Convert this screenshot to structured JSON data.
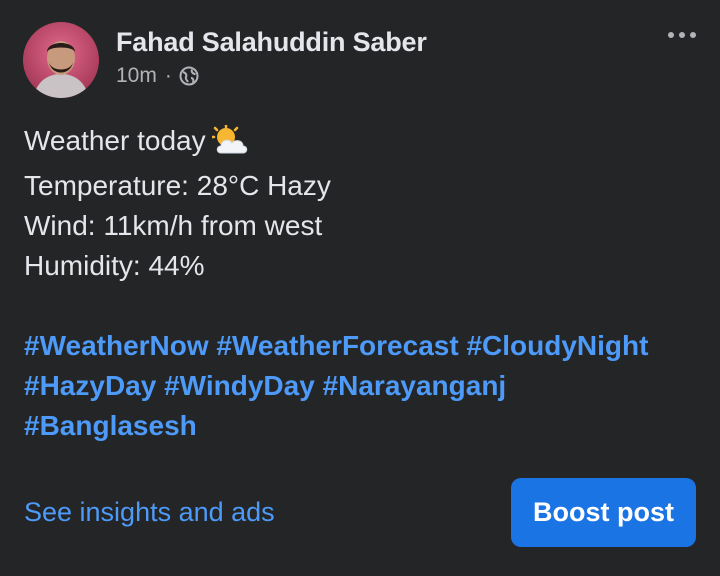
{
  "post": {
    "author": "Fahad Salahuddin Saber",
    "timestamp": "10m",
    "separator": "·",
    "privacy_icon": "globe-icon",
    "more_icon": "more-options-icon",
    "body": {
      "line1": "Weather today",
      "line1_emoji": "sun-behind-cloud-icon",
      "line2": "Temperature: 28°C Hazy",
      "line3": "Wind: 11km/h from west",
      "line4": "Humidity: 44%"
    },
    "hashtags": {
      "row1": [
        "#WeatherNow",
        "#WeatherForecast",
        "#CloudyNight"
      ],
      "row2": [
        "#HazyDay",
        "#WindyDay",
        "#Narayanganj"
      ],
      "row3": [
        "#Banglasesh"
      ]
    },
    "footer": {
      "insights_link": "See insights and ads",
      "boost_button": "Boost post"
    }
  },
  "colors": {
    "background": "#242526",
    "text_primary": "#e4e6eb",
    "text_secondary": "#b0b3b8",
    "link": "#4d9af8",
    "button": "#1b74e4"
  }
}
